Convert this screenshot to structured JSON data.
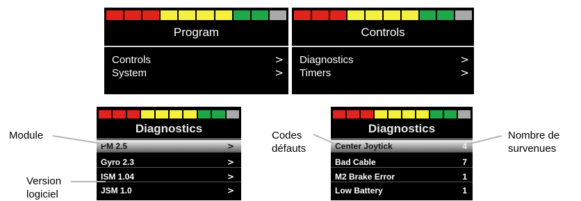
{
  "level_bar": {
    "colors": [
      "#e1231e",
      "#e1231e",
      "#e1231e",
      "#f5f03c",
      "#f5f03c",
      "#f5f03c",
      "#f5f03c",
      "#1fa84a",
      "#1fa84a",
      "#a9a9a9"
    ]
  },
  "screens": {
    "program": {
      "title": "Program",
      "items": [
        {
          "label": "Controls",
          "indicator": ">"
        },
        {
          "label": "System",
          "indicator": ">"
        }
      ]
    },
    "controls": {
      "title": "Controls",
      "items": [
        {
          "label": "Diagnostics",
          "indicator": ">"
        },
        {
          "label": "Timers",
          "indicator": ">"
        }
      ]
    },
    "diagnostics_modules": {
      "title": "Diagnostics",
      "items": [
        {
          "label": "PM 2.5",
          "indicator": ">"
        },
        {
          "label": "Gyro 2.3",
          "indicator": ">"
        },
        {
          "label": "ISM 1.04",
          "indicator": ">"
        },
        {
          "label": "JSM 1.0",
          "indicator": ">"
        }
      ]
    },
    "diagnostics_faults": {
      "title": "Diagnostics",
      "items": [
        {
          "label": "Center Joytick",
          "indicator": "4"
        },
        {
          "label": "Bad Cable",
          "indicator": "7"
        },
        {
          "label": "M2 Brake Error",
          "indicator": "1"
        },
        {
          "label": "Low Battery",
          "indicator": "1"
        }
      ]
    }
  },
  "annotations": {
    "module": "Module",
    "version_1": "Version",
    "version_2": "logiciel",
    "codes_1": "Codes",
    "codes_2": "défauts",
    "count_1": "Nombre de",
    "count_2": "survenues"
  }
}
